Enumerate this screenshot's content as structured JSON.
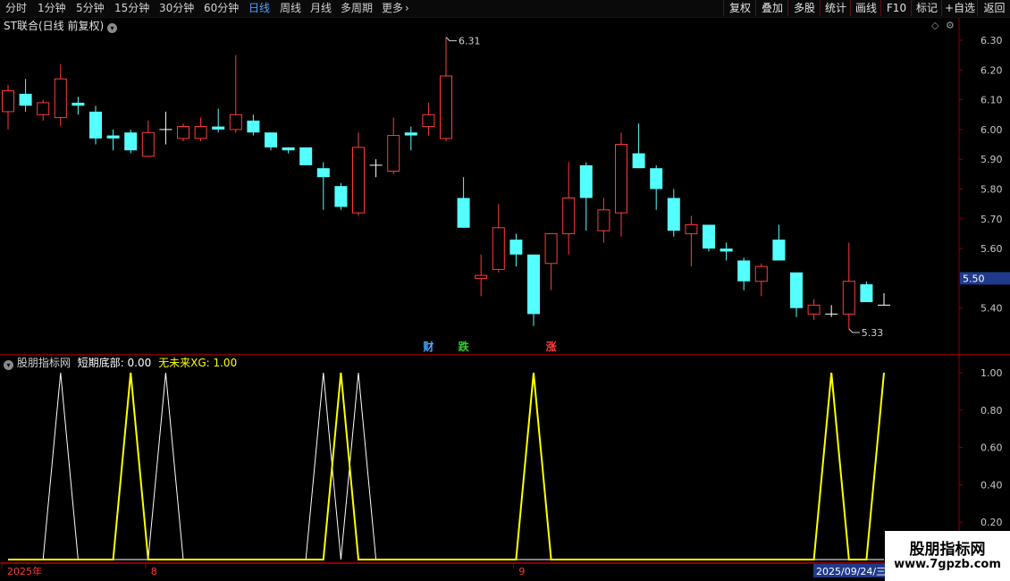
{
  "toolbar": {
    "periods": [
      "分时",
      "1分钟",
      "5分钟",
      "15分钟",
      "30分钟",
      "60分钟",
      "日线",
      "周线",
      "月线",
      "多周期",
      "更多"
    ],
    "active_period": "日线",
    "more_arrow": "›",
    "buttons": [
      "复权",
      "叠加",
      "多股",
      "统计",
      "画线",
      "F10",
      "标记",
      "+自选",
      "返回"
    ]
  },
  "price_panel": {
    "title": "ST联合(日线 前复权)",
    "y_axis": {
      "min": 5.3,
      "max": 6.33,
      "ticks": [
        "6.30",
        "6.20",
        "6.10",
        "6.00",
        "5.90",
        "5.80",
        "5.70",
        "5.60",
        "5.50",
        "5.40"
      ]
    },
    "current_price": "5.50",
    "high_label": "6.31",
    "low_label": "5.33",
    "markers": [
      {
        "text": "财",
        "index": 24,
        "color": "#4fa8ff"
      },
      {
        "text": "跌",
        "index": 26,
        "color": "#30d030"
      },
      {
        "text": "涨",
        "index": 31,
        "color": "#ff4040"
      }
    ],
    "candles": [
      [
        6.06,
        6.13,
        6.15,
        6.0
      ],
      [
        6.12,
        6.08,
        6.17,
        6.06
      ],
      [
        6.05,
        6.09,
        6.1,
        6.03
      ],
      [
        6.04,
        6.17,
        6.22,
        6.01
      ],
      [
        6.09,
        6.08,
        6.11,
        6.05
      ],
      [
        6.06,
        5.97,
        6.08,
        5.95
      ],
      [
        5.98,
        5.97,
        6.0,
        5.93
      ],
      [
        5.99,
        5.93,
        6.0,
        5.92
      ],
      [
        5.91,
        5.99,
        6.03,
        5.91
      ],
      [
        6.0,
        6.0,
        6.06,
        5.95
      ],
      [
        5.97,
        6.01,
        6.02,
        5.96
      ],
      [
        5.97,
        6.01,
        6.04,
        5.96
      ],
      [
        6.01,
        6.0,
        6.07,
        5.99
      ],
      [
        6.0,
        6.05,
        6.25,
        5.99
      ],
      [
        6.03,
        5.99,
        6.05,
        5.98
      ],
      [
        5.99,
        5.94,
        5.99,
        5.93
      ],
      [
        5.94,
        5.93,
        5.94,
        5.92
      ],
      [
        5.94,
        5.88,
        5.94,
        5.88
      ],
      [
        5.87,
        5.84,
        5.89,
        5.73
      ],
      [
        5.81,
        5.74,
        5.82,
        5.73
      ],
      [
        5.72,
        5.94,
        5.99,
        5.71
      ],
      [
        5.88,
        5.88,
        5.9,
        5.84
      ],
      [
        5.86,
        5.98,
        6.04,
        5.85
      ],
      [
        5.99,
        5.98,
        6.01,
        5.93
      ],
      [
        6.01,
        6.05,
        6.09,
        5.98
      ],
      [
        5.97,
        6.18,
        6.31,
        5.96
      ],
      [
        5.77,
        5.67,
        5.84,
        5.67
      ],
      [
        5.5,
        5.51,
        5.58,
        5.44
      ],
      [
        5.53,
        5.67,
        5.75,
        5.52
      ],
      [
        5.63,
        5.58,
        5.65,
        5.54
      ],
      [
        5.58,
        5.38,
        5.58,
        5.34
      ],
      [
        5.55,
        5.65,
        5.65,
        5.46
      ],
      [
        5.65,
        5.77,
        5.89,
        5.58
      ],
      [
        5.88,
        5.77,
        5.89,
        5.66
      ],
      [
        5.66,
        5.73,
        5.77,
        5.62
      ],
      [
        5.72,
        5.95,
        5.99,
        5.64
      ],
      [
        5.92,
        5.87,
        6.02,
        5.87
      ],
      [
        5.87,
        5.8,
        5.88,
        5.73
      ],
      [
        5.77,
        5.66,
        5.8,
        5.64
      ],
      [
        5.65,
        5.68,
        5.71,
        5.54
      ],
      [
        5.68,
        5.6,
        5.68,
        5.59
      ],
      [
        5.6,
        5.59,
        5.62,
        5.56
      ],
      [
        5.56,
        5.49,
        5.57,
        5.46
      ],
      [
        5.49,
        5.54,
        5.55,
        5.44
      ],
      [
        5.63,
        5.56,
        5.68,
        5.56
      ],
      [
        5.52,
        5.4,
        5.52,
        5.37
      ],
      [
        5.38,
        5.41,
        5.43,
        5.36
      ],
      [
        5.38,
        5.38,
        5.41,
        5.37
      ],
      [
        5.38,
        5.49,
        5.62,
        5.33
      ],
      [
        5.48,
        5.42,
        5.49,
        5.42
      ],
      [
        5.41,
        5.41,
        5.45,
        5.41
      ]
    ]
  },
  "indicator_panel": {
    "name": "股朋指标网",
    "label1": "短期底部",
    "value1": "0.00",
    "label2": "无未来XG",
    "value2": "1.00",
    "y_axis": {
      "min": 0,
      "max": 1.0,
      "ticks": [
        "1.00",
        "0.80",
        "0.60",
        "0.40",
        "0.20"
      ]
    },
    "white_signal_indices": [
      3,
      9,
      18,
      20
    ],
    "yellow_signal_indices": [
      7,
      19,
      30,
      47,
      50
    ]
  },
  "time_axis": {
    "labels": [
      {
        "text": "2025年",
        "index": 0
      },
      {
        "text": "8",
        "index": 8
      },
      {
        "text": "9",
        "index": 29
      }
    ],
    "cursor_date": "2025/09/24/三"
  },
  "watermark": {
    "title": "股朋指标网",
    "url": "www.7gpzb.com"
  },
  "colors": {
    "up": "#ff3b3b",
    "down": "#54ffff",
    "yellow": "#ffff00",
    "axis": "#8b0000"
  }
}
